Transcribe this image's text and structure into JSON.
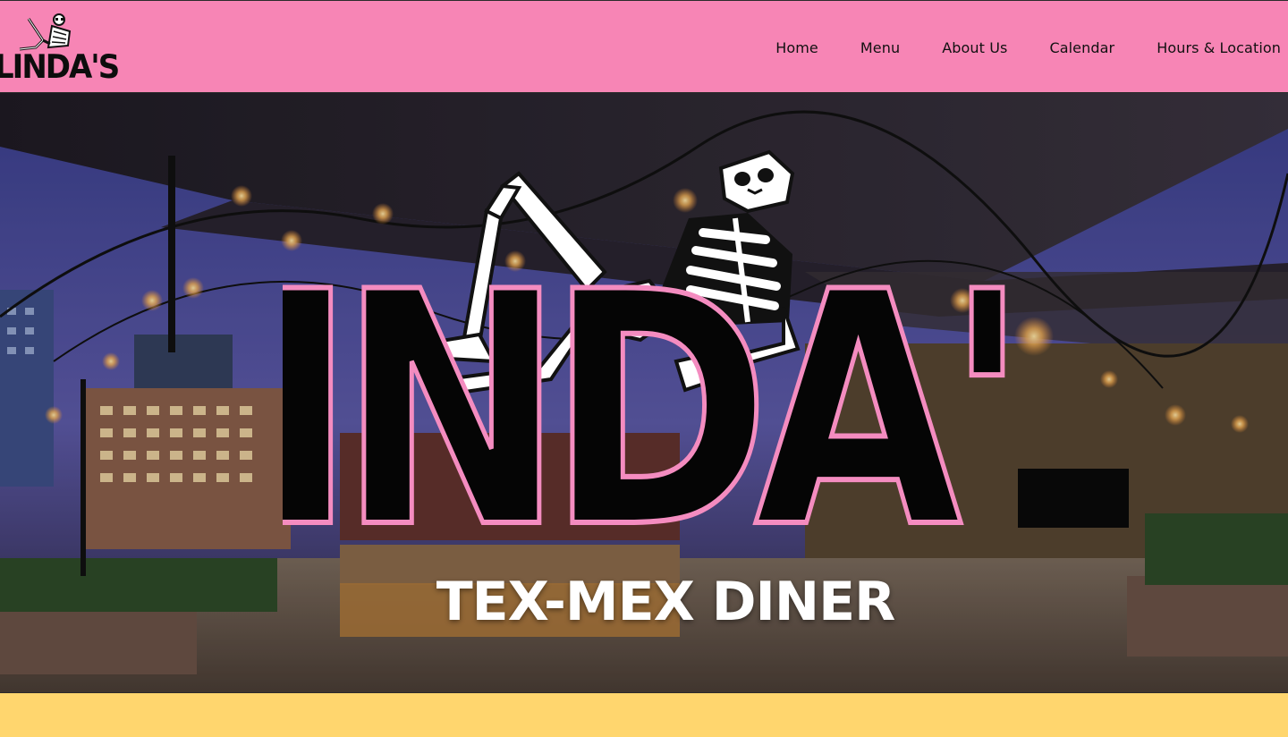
{
  "brand": {
    "name": "LINDA'S",
    "tagline": "TEX-MEX DINER"
  },
  "nav": {
    "items": [
      {
        "label": "Home"
      },
      {
        "label": "Menu"
      },
      {
        "label": "About Us"
      },
      {
        "label": "Calendar"
      },
      {
        "label": "Hours & Location"
      }
    ]
  },
  "colors": {
    "nav_bg": "#f785b5",
    "footer_band": "#ffd66e",
    "logo_outline": "#f48cc0",
    "text_dark": "#111111"
  },
  "icons": {
    "logo_small": "skeleton-logo-icon",
    "hero_logo": "skeleton-hero-logo"
  }
}
